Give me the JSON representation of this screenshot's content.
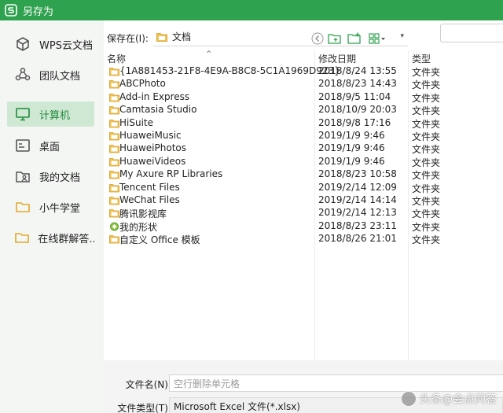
{
  "window": {
    "title": "另存为"
  },
  "sidebar": {
    "items": [
      {
        "label": "WPS云文档",
        "icon": "cube-icon"
      },
      {
        "label": "团队文档",
        "icon": "team-icon"
      },
      {
        "label": "计算机",
        "icon": "monitor-icon",
        "active": true
      },
      {
        "label": "桌面",
        "icon": "desktop-icon"
      },
      {
        "label": "我的文档",
        "icon": "my-documents-icon"
      },
      {
        "label": "小牛学堂",
        "icon": "folder-icon"
      },
      {
        "label": "在线群解答...",
        "icon": "folder-icon"
      }
    ]
  },
  "toolbar": {
    "save_in_label": "保存在(I):",
    "location": "文档"
  },
  "filelist": {
    "columns": {
      "name": "名称",
      "date": "修改日期",
      "type": "类型"
    },
    "rows": [
      {
        "name": "{1A881453-21F8-4E9A-B8C8-5C1A1969D923}",
        "date": "2018/8/24 13:55",
        "type": "文件夹"
      },
      {
        "name": "ABCPhoto",
        "date": "2018/8/23 14:43",
        "type": "文件夹"
      },
      {
        "name": "Add-in Express",
        "date": "2018/9/5 11:04",
        "type": "文件夹"
      },
      {
        "name": "Camtasia Studio",
        "date": "2018/10/9 20:03",
        "type": "文件夹"
      },
      {
        "name": "HiSuite",
        "date": "2018/9/8 17:16",
        "type": "文件夹"
      },
      {
        "name": "HuaweiMusic",
        "date": "2019/1/9 9:46",
        "type": "文件夹"
      },
      {
        "name": "HuaweiPhotos",
        "date": "2019/1/9 9:46",
        "type": "文件夹"
      },
      {
        "name": "HuaweiVideos",
        "date": "2019/1/9 9:46",
        "type": "文件夹"
      },
      {
        "name": "My Axure RP Libraries",
        "date": "2018/8/23 10:58",
        "type": "文件夹"
      },
      {
        "name": "Tencent Files",
        "date": "2019/2/14 12:09",
        "type": "文件夹"
      },
      {
        "name": "WeChat Files",
        "date": "2019/2/14 14:14",
        "type": "文件夹"
      },
      {
        "name": "腾讯影视库",
        "date": "2019/2/14 12:13",
        "type": "文件夹"
      },
      {
        "name": "我的形状",
        "date": "2018/8/23 23:11",
        "type": "文件夹",
        "special_icon": true
      },
      {
        "name": "自定义 Office 模板",
        "date": "2018/8/26 21:01",
        "type": "文件夹"
      }
    ]
  },
  "bottom": {
    "filename_label": "文件名(N):",
    "filename_placeholder": "空行删除单元格",
    "filetype_label": "文件类型(T):",
    "filetype_value": "Microsoft Excel 文件(*.xlsx)"
  },
  "watermark": {
    "text": "头条@会点问答"
  },
  "colors": {
    "brand": "#2fa24f",
    "active_bg": "#cfe8d3",
    "folder": "#f2c14e"
  }
}
